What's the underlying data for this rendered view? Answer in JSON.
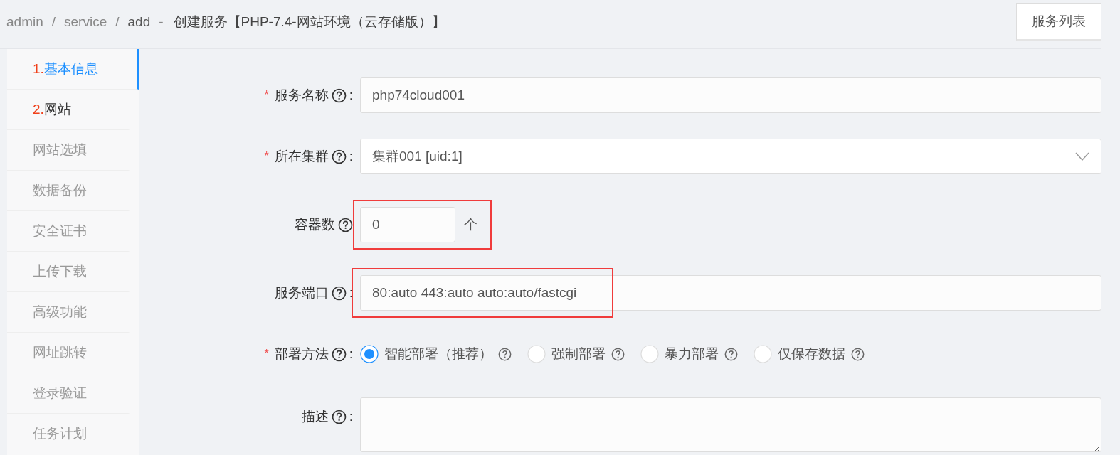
{
  "breadcrumb": {
    "items": [
      {
        "label": "admin"
      },
      {
        "separator": "/",
        "label": "service"
      },
      {
        "separator": "/",
        "label": "add"
      }
    ],
    "title_separator": "-",
    "title": "创建服务【PHP-7.4-网站环境（云存储版）】"
  },
  "header_button": "服务列表",
  "sidebar": {
    "items": [
      {
        "number": "1.",
        "label": "基本信息",
        "kind": "step",
        "selected": true
      },
      {
        "number": "2.",
        "label": "网站",
        "kind": "step",
        "selected": false
      },
      {
        "label": "网站选填",
        "kind": "optional",
        "selected": false
      },
      {
        "label": "数据备份",
        "kind": "optional",
        "selected": false
      },
      {
        "label": "安全证书",
        "kind": "optional",
        "selected": false
      },
      {
        "label": "上传下载",
        "kind": "optional",
        "selected": false
      },
      {
        "label": "高级功能",
        "kind": "optional",
        "selected": false
      },
      {
        "label": "网址跳转",
        "kind": "optional",
        "selected": false
      },
      {
        "label": "登录验证",
        "kind": "optional",
        "selected": false
      },
      {
        "label": "任务计划",
        "kind": "optional",
        "selected": false
      }
    ]
  },
  "form": {
    "fields": [
      {
        "kind": "text",
        "required_mark": "*",
        "label": "服务名称",
        "colon": ":",
        "value": "php74cloud001"
      },
      {
        "kind": "select",
        "required_mark": "*",
        "label": "所在集群",
        "colon": ":",
        "value": "集群001 [uid:1]"
      },
      {
        "kind": "number",
        "label": "容器数",
        "value": "0",
        "unit": "个",
        "highlighted": true
      },
      {
        "kind": "text",
        "label": "服务端口",
        "colon": ":",
        "value": "80:auto 443:auto auto:auto/fastcgi",
        "highlighted": true
      },
      {
        "kind": "radio",
        "required_mark": "*",
        "label": "部署方法",
        "colon": ":",
        "options": [
          {
            "label": "智能部署（推荐）",
            "selected": true
          },
          {
            "label": "强制部署",
            "selected": false
          },
          {
            "label": "暴力部署",
            "selected": false
          },
          {
            "label": "仅保存数据",
            "selected": false
          }
        ]
      },
      {
        "kind": "textarea",
        "label": "描述",
        "colon": ":"
      }
    ]
  }
}
